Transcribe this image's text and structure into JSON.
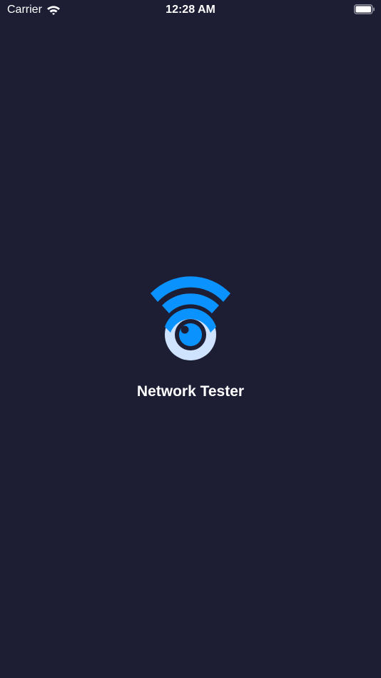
{
  "status_bar": {
    "carrier": "Carrier",
    "time": "12:28 AM",
    "icons": [
      "wifi-icon",
      "battery-icon"
    ]
  },
  "splash": {
    "app_name": "Network Tester",
    "logo_icon": "network-eye-logo-icon"
  },
  "colors": {
    "background": "#1d1e34",
    "accent_blue": "#0a93ff",
    "eye_ring": "#cfe3ff",
    "text": "#ffffff"
  }
}
